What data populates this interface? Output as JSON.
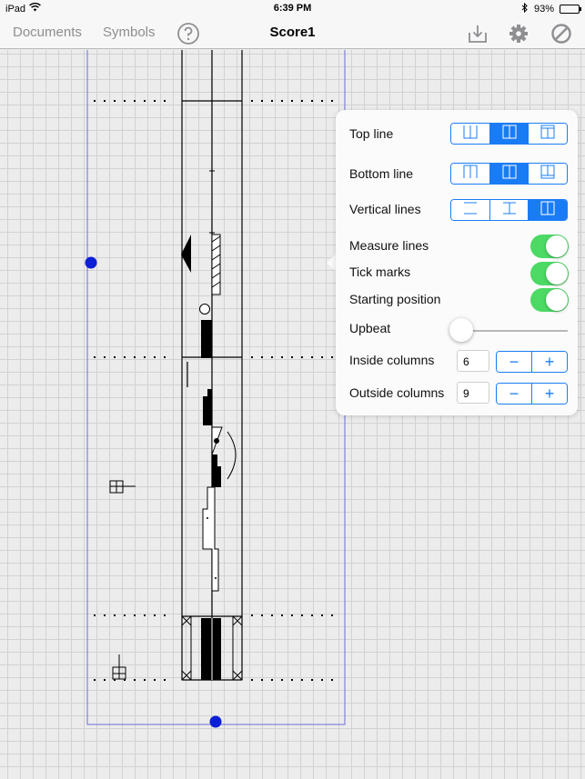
{
  "status_bar": {
    "device": "iPad",
    "time": "6:39 PM",
    "battery": "93%",
    "battery_level": 0.93
  },
  "nav": {
    "documents": "Documents",
    "symbols": "Symbols",
    "title": "Score1",
    "help_icon": "question-circle-icon",
    "export_icon": "download-tray-icon",
    "settings_icon": "gear-icon",
    "clear_icon": "prohibited-icon"
  },
  "popover": {
    "top_line": {
      "label": "Top line",
      "options": [
        "open-top",
        "closed",
        "double-top"
      ],
      "selected_index": 1
    },
    "bottom_line": {
      "label": "Bottom line",
      "options": [
        "open-bottom",
        "closed",
        "double-bottom"
      ],
      "selected_index": 1
    },
    "vertical_lines": {
      "label": "Vertical lines",
      "options": [
        "none",
        "center",
        "full"
      ],
      "selected_index": 2
    },
    "measure_lines": {
      "label": "Measure lines",
      "on": true
    },
    "tick_marks": {
      "label": "Tick marks",
      "on": true
    },
    "starting_position": {
      "label": "Starting position",
      "on": true
    },
    "upbeat": {
      "label": "Upbeat",
      "value": 0
    },
    "inside_columns": {
      "label": "Inside columns",
      "value": "6",
      "minus": "−",
      "plus": "+"
    },
    "outside_columns": {
      "label": "Outside columns",
      "value": "9",
      "minus": "−",
      "plus": "+"
    }
  },
  "colors": {
    "accent": "#1a7cf5",
    "toggle_on": "#4cd964",
    "page_border": "#6e6ad8",
    "handle": "#0b1fd6"
  }
}
